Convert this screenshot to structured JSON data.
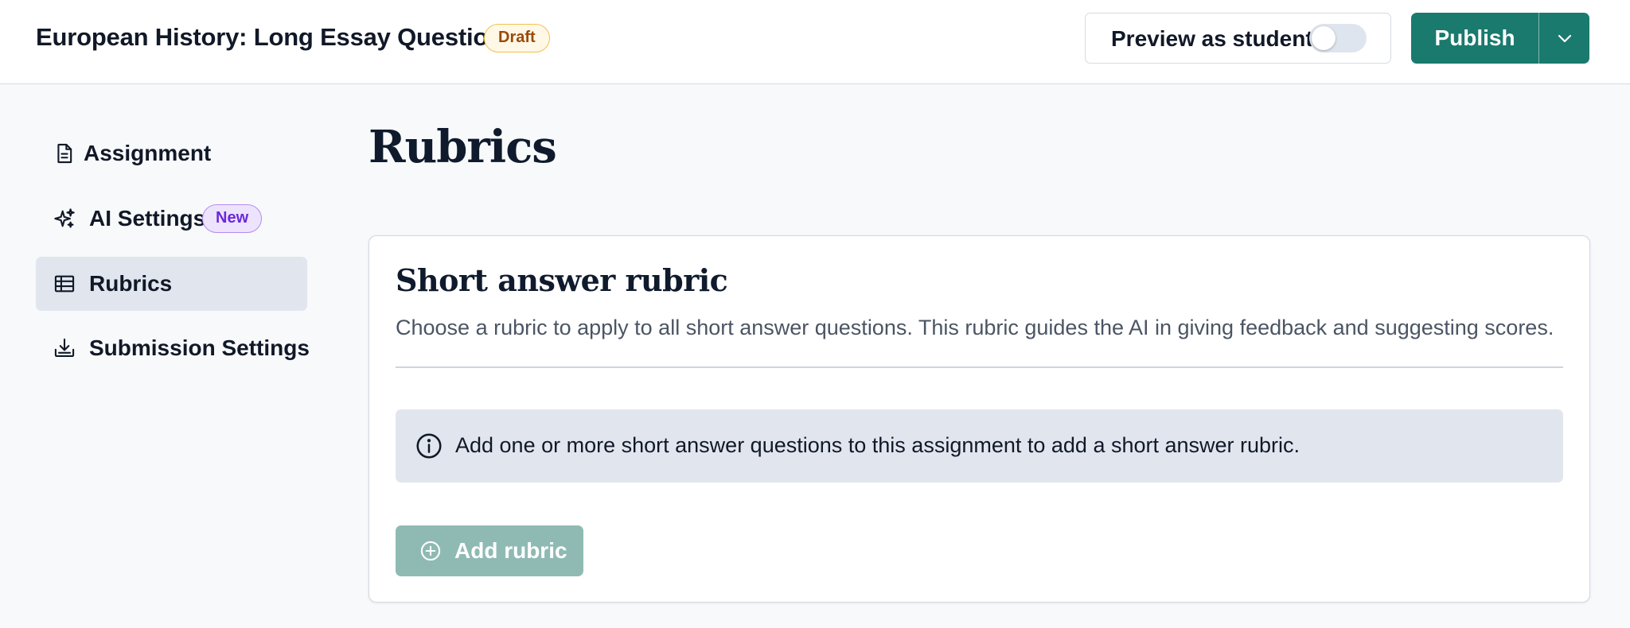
{
  "header": {
    "title": "European History: Long Essay Question",
    "status_badge": "Draft",
    "preview_label": "Preview as student",
    "preview_toggle_on": false,
    "publish_label": "Publish"
  },
  "sidebar": {
    "items": [
      {
        "label": "Assignment",
        "icon": "document-icon",
        "active": false
      },
      {
        "label": "AI Settings",
        "icon": "sparkle-icon",
        "badge": "New",
        "active": false
      },
      {
        "label": "Rubrics",
        "icon": "table-icon",
        "active": true
      },
      {
        "label": "Submission Settings",
        "icon": "download-tray-icon",
        "active": false
      }
    ]
  },
  "main": {
    "page_title": "Rubrics",
    "card": {
      "title": "Short answer rubric",
      "description": "Choose a rubric to apply to all short answer questions. This rubric guides the AI in giving feedback and suggesting scores.",
      "info_message": "Add one or more short answer questions to this assignment to add a short answer rubric.",
      "add_button_label": "Add rubric",
      "add_button_disabled": true
    }
  },
  "colors": {
    "brand_teal": "#1a7a6e",
    "disabled_teal": "#8fbab4",
    "draft_badge": "#fff8e6",
    "new_badge": "#ede3fd",
    "active_nav": "#e1e6ee"
  }
}
